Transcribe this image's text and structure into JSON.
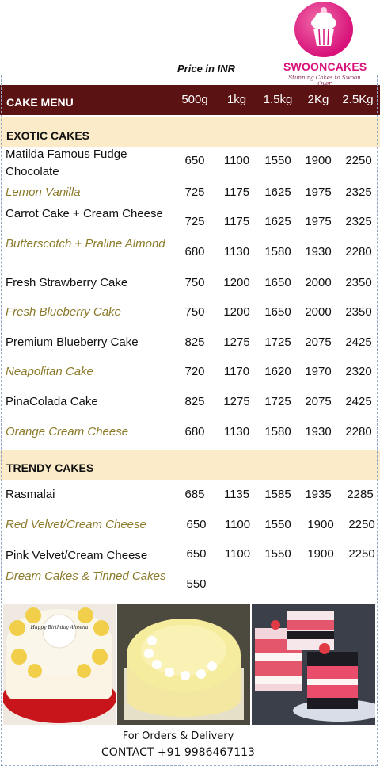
{
  "logo": {
    "name": "SWOONCAKES",
    "tagline": "Stunning Cakes to Swoon Over"
  },
  "price_note": "Price in INR",
  "menu": {
    "title": "CAKE MENU",
    "sizes": [
      "500g",
      "1kg",
      "1.5kg",
      "2Kg",
      "2.5Kg"
    ]
  },
  "sections": [
    {
      "title": "EXOTIC CAKES",
      "items": [
        {
          "name": "Matilda Famous Fudge Chocolate",
          "prices": [
            "650",
            "1100",
            "1550",
            "1900",
            "2250"
          ]
        },
        {
          "name": "Lemon Vanilla",
          "prices": [
            "725",
            "1175",
            "1625",
            "1975",
            "2325"
          ]
        },
        {
          "name": "Carrot Cake + Cream Cheese",
          "prices": [
            "725",
            "1175",
            "1625",
            "1975",
            "2325"
          ]
        },
        {
          "name": "Butterscotch + Praline Almond",
          "prices": [
            "680",
            "1130",
            "1580",
            "1930",
            "2280"
          ]
        },
        {
          "name": "Fresh Strawberry Cake",
          "prices": [
            "750",
            "1200",
            "1650",
            "2000",
            "2350"
          ]
        },
        {
          "name": "Fresh Blueberry Cake",
          "prices": [
            "750",
            "1200",
            "1650",
            "2000",
            "2350"
          ]
        },
        {
          "name": "Premium Blueberry Cake",
          "prices": [
            "825",
            "1275",
            "1725",
            "2075",
            "2425"
          ]
        },
        {
          "name": "Neapolitan Cake",
          "prices": [
            "720",
            "1170",
            "1620",
            "1970",
            "2320"
          ]
        },
        {
          "name": "PinaColada Cake",
          "prices": [
            "825",
            "1275",
            "1725",
            "2075",
            "2425"
          ]
        },
        {
          "name": "Orange Cream Cheese",
          "prices": [
            "680",
            "1130",
            "1580",
            "1930",
            "2280"
          ]
        }
      ]
    },
    {
      "title": "TRENDY CAKES",
      "items": [
        {
          "name": "Rasmalai",
          "prices": [
            "685",
            "1135",
            "1585",
            "1935",
            "2285"
          ]
        },
        {
          "name": "Red Velvet/Cream Cheese",
          "prices": [
            "650",
            "1100",
            "1550",
            "1900",
            "2250"
          ]
        },
        {
          "name": "Pink Velvet/Cream Cheese",
          "prices": [
            "650",
            "1100",
            "1550",
            "1900",
            "2250"
          ]
        },
        {
          "name": "Dream Cakes & Tinned Cakes",
          "prices": [
            "550"
          ]
        }
      ]
    }
  ],
  "photos": [
    {
      "subject": "birthday cake with yellow rosettes",
      "inscription": "Happy Birthday Aheena"
    },
    {
      "subject": "pineapple cake with white piping"
    },
    {
      "subject": "pink velvet cake slices"
    }
  ],
  "footer": {
    "line1": "For Orders & Delivery",
    "line2": "CONTACT +91 9986467113"
  },
  "colors": {
    "header_bg": "#5b1213",
    "section_bg": "#fbebc8",
    "alt_text": "#8b7a2a",
    "brand": "#d8127a"
  }
}
